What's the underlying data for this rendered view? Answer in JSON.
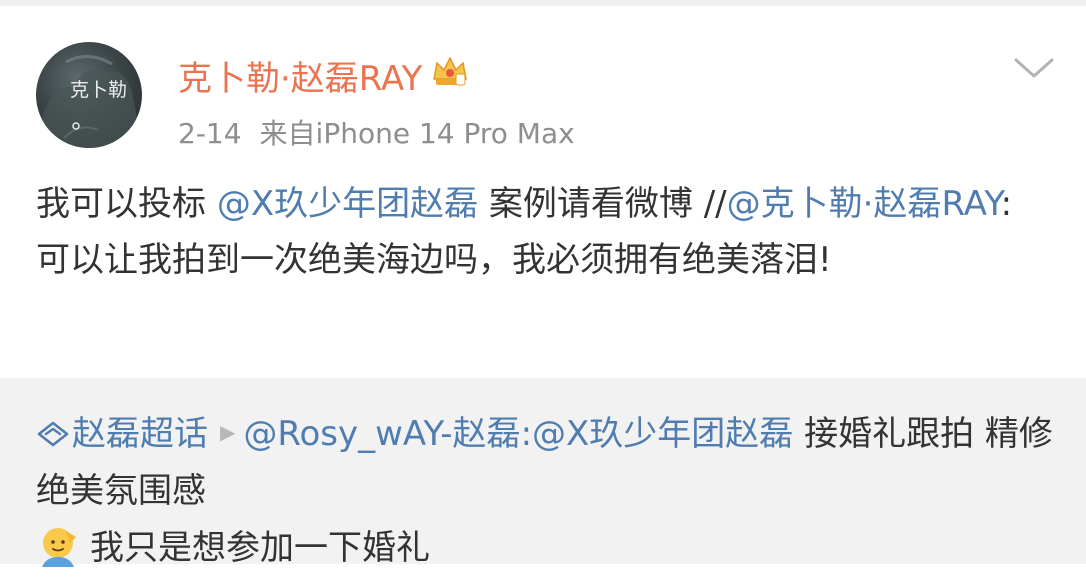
{
  "post": {
    "author": "克卜勒·赵磊RAY",
    "avatar_text": "克卜勒",
    "date": "2-14",
    "source": "来自iPhone 14 Pro Max",
    "text_1": "我可以投标",
    "mention_1": "@X玖少年团赵磊",
    "text_2": " 案例请看微博 //",
    "mention_2": "@克卜勒·赵磊RAY",
    "text_3": ":可以让我拍到一次绝美海边吗，我必须拥有绝美落泪!"
  },
  "repost": {
    "topic": "赵磊超话",
    "mention_user": "@Rosy_wAY-赵磊",
    "mention_2": ":@X玖少年团赵磊",
    "text_1": " 接婚礼跟拍 精修绝美氛围感",
    "text_2": "我只是想参加一下婚礼"
  },
  "icons": {
    "vip": "crown-badge-icon",
    "menu": "chevron-down-icon",
    "topic": "diamond-topic-icon",
    "arrow": "play-arrow-icon",
    "emoji": "salute-emoji-icon"
  },
  "colors": {
    "author": "#eb7350",
    "link": "#507daf",
    "text": "#333333",
    "meta": "#8e8e8e",
    "repost_bg": "#f2f2f2"
  }
}
